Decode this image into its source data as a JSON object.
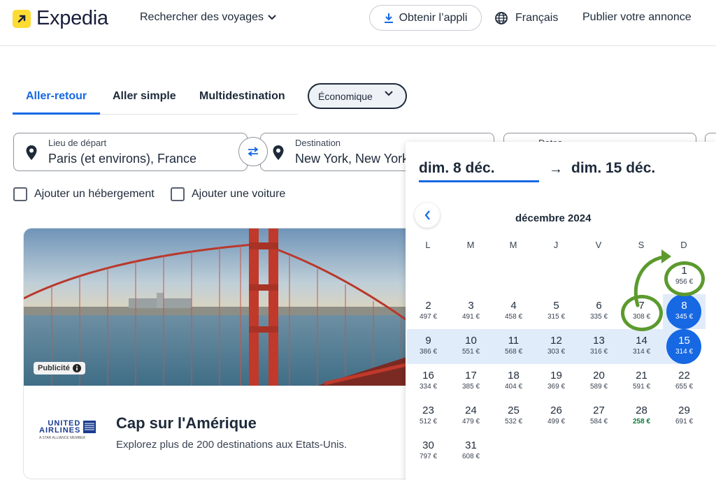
{
  "header": {
    "logo_text": "Expedia",
    "nav_trips": "Rechercher des voyages",
    "get_app": "Obtenir l’appli",
    "language": "Français",
    "publish": "Publier votre annonce"
  },
  "tabs": [
    {
      "label": "Aller-retour",
      "active": true
    },
    {
      "label": "Aller simple",
      "active": false
    },
    {
      "label": "Multidestination",
      "active": false
    }
  ],
  "cabin_class": "Économique",
  "search": {
    "origin_label": "Lieu de départ",
    "origin_value": "Paris (et environs), France",
    "destination_label": "Destination",
    "destination_value": "New York, New York",
    "dates_label": "Dates"
  },
  "options": {
    "add_hotel": "Ajouter un hébergement",
    "add_car": "Ajouter une voiture"
  },
  "ad": {
    "badge": "Publicité",
    "brand_line1": "UNITED",
    "brand_line2": "AIRLINES",
    "brand_tagline": "A STAR ALLIANCE MEMBER",
    "title": "Cap sur l'Amérique",
    "subtitle": "Explorez plus de 200 destinations aux Etats-Unis."
  },
  "calendar": {
    "start_date": "dim. 8 déc.",
    "end_date": "dim. 15 déc.",
    "arrow": "→",
    "month": "décembre 2024",
    "weekdays": [
      "L",
      "M",
      "M",
      "J",
      "V",
      "S",
      "D"
    ],
    "days": [
      {
        "d": "1",
        "p": "956 €"
      },
      {
        "d": "2",
        "p": "497 €"
      },
      {
        "d": "3",
        "p": "491 €"
      },
      {
        "d": "4",
        "p": "458 €"
      },
      {
        "d": "5",
        "p": "315 €"
      },
      {
        "d": "6",
        "p": "335 €"
      },
      {
        "d": "7",
        "p": "308 €"
      },
      {
        "d": "8",
        "p": "345 €"
      },
      {
        "d": "9",
        "p": "386 €"
      },
      {
        "d": "10",
        "p": "551 €"
      },
      {
        "d": "11",
        "p": "568 €"
      },
      {
        "d": "12",
        "p": "303 €"
      },
      {
        "d": "13",
        "p": "316 €"
      },
      {
        "d": "14",
        "p": "314 €"
      },
      {
        "d": "15",
        "p": "314 €"
      },
      {
        "d": "16",
        "p": "334 €"
      },
      {
        "d": "17",
        "p": "385 €"
      },
      {
        "d": "18",
        "p": "404 €"
      },
      {
        "d": "19",
        "p": "369 €"
      },
      {
        "d": "20",
        "p": "589 €"
      },
      {
        "d": "21",
        "p": "591 €"
      },
      {
        "d": "22",
        "p": "655 €"
      },
      {
        "d": "23",
        "p": "512 €"
      },
      {
        "d": "24",
        "p": "479 €"
      },
      {
        "d": "25",
        "p": "532 €"
      },
      {
        "d": "26",
        "p": "499 €"
      },
      {
        "d": "27",
        "p": "584 €"
      },
      {
        "d": "28",
        "p": "258 €"
      },
      {
        "d": "29",
        "p": "691 €"
      },
      {
        "d": "30",
        "p": "797 €"
      },
      {
        "d": "31",
        "p": "608 €"
      }
    ]
  },
  "colors": {
    "accent": "#1668e3",
    "range": "#e1ecfb",
    "annotation": "#5c9a2e",
    "lowest_price": "#0a7a3b"
  }
}
